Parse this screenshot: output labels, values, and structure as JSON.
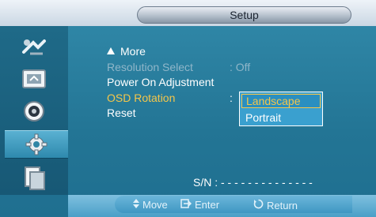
{
  "window": {
    "title": "Setup"
  },
  "sidebar": {
    "items": [
      {
        "icon": "picture-icon"
      },
      {
        "icon": "display-size-icon"
      },
      {
        "icon": "sound-icon"
      },
      {
        "icon": "setup-gear-icon",
        "active": true
      },
      {
        "icon": "input-source-icon"
      }
    ]
  },
  "menu": {
    "more_label": "More",
    "items": [
      {
        "label": "Resolution Select",
        "value": ": Off"
      },
      {
        "label": "Power On Adjustment"
      },
      {
        "label": "OSD Rotation",
        "value": ":"
      },
      {
        "label": "Reset"
      }
    ]
  },
  "dropdown": {
    "options": [
      "Landscape",
      "Portrait"
    ],
    "selected": "Landscape"
  },
  "serial": "S/N : - - - - - - - - - - - - - -",
  "footer": {
    "move": "Move",
    "enter": "Enter",
    "return": "Return"
  },
  "colors": {
    "accent": "#f4c64a",
    "panel": "#2479a0",
    "dimmed_text": "#8fb6c9"
  }
}
